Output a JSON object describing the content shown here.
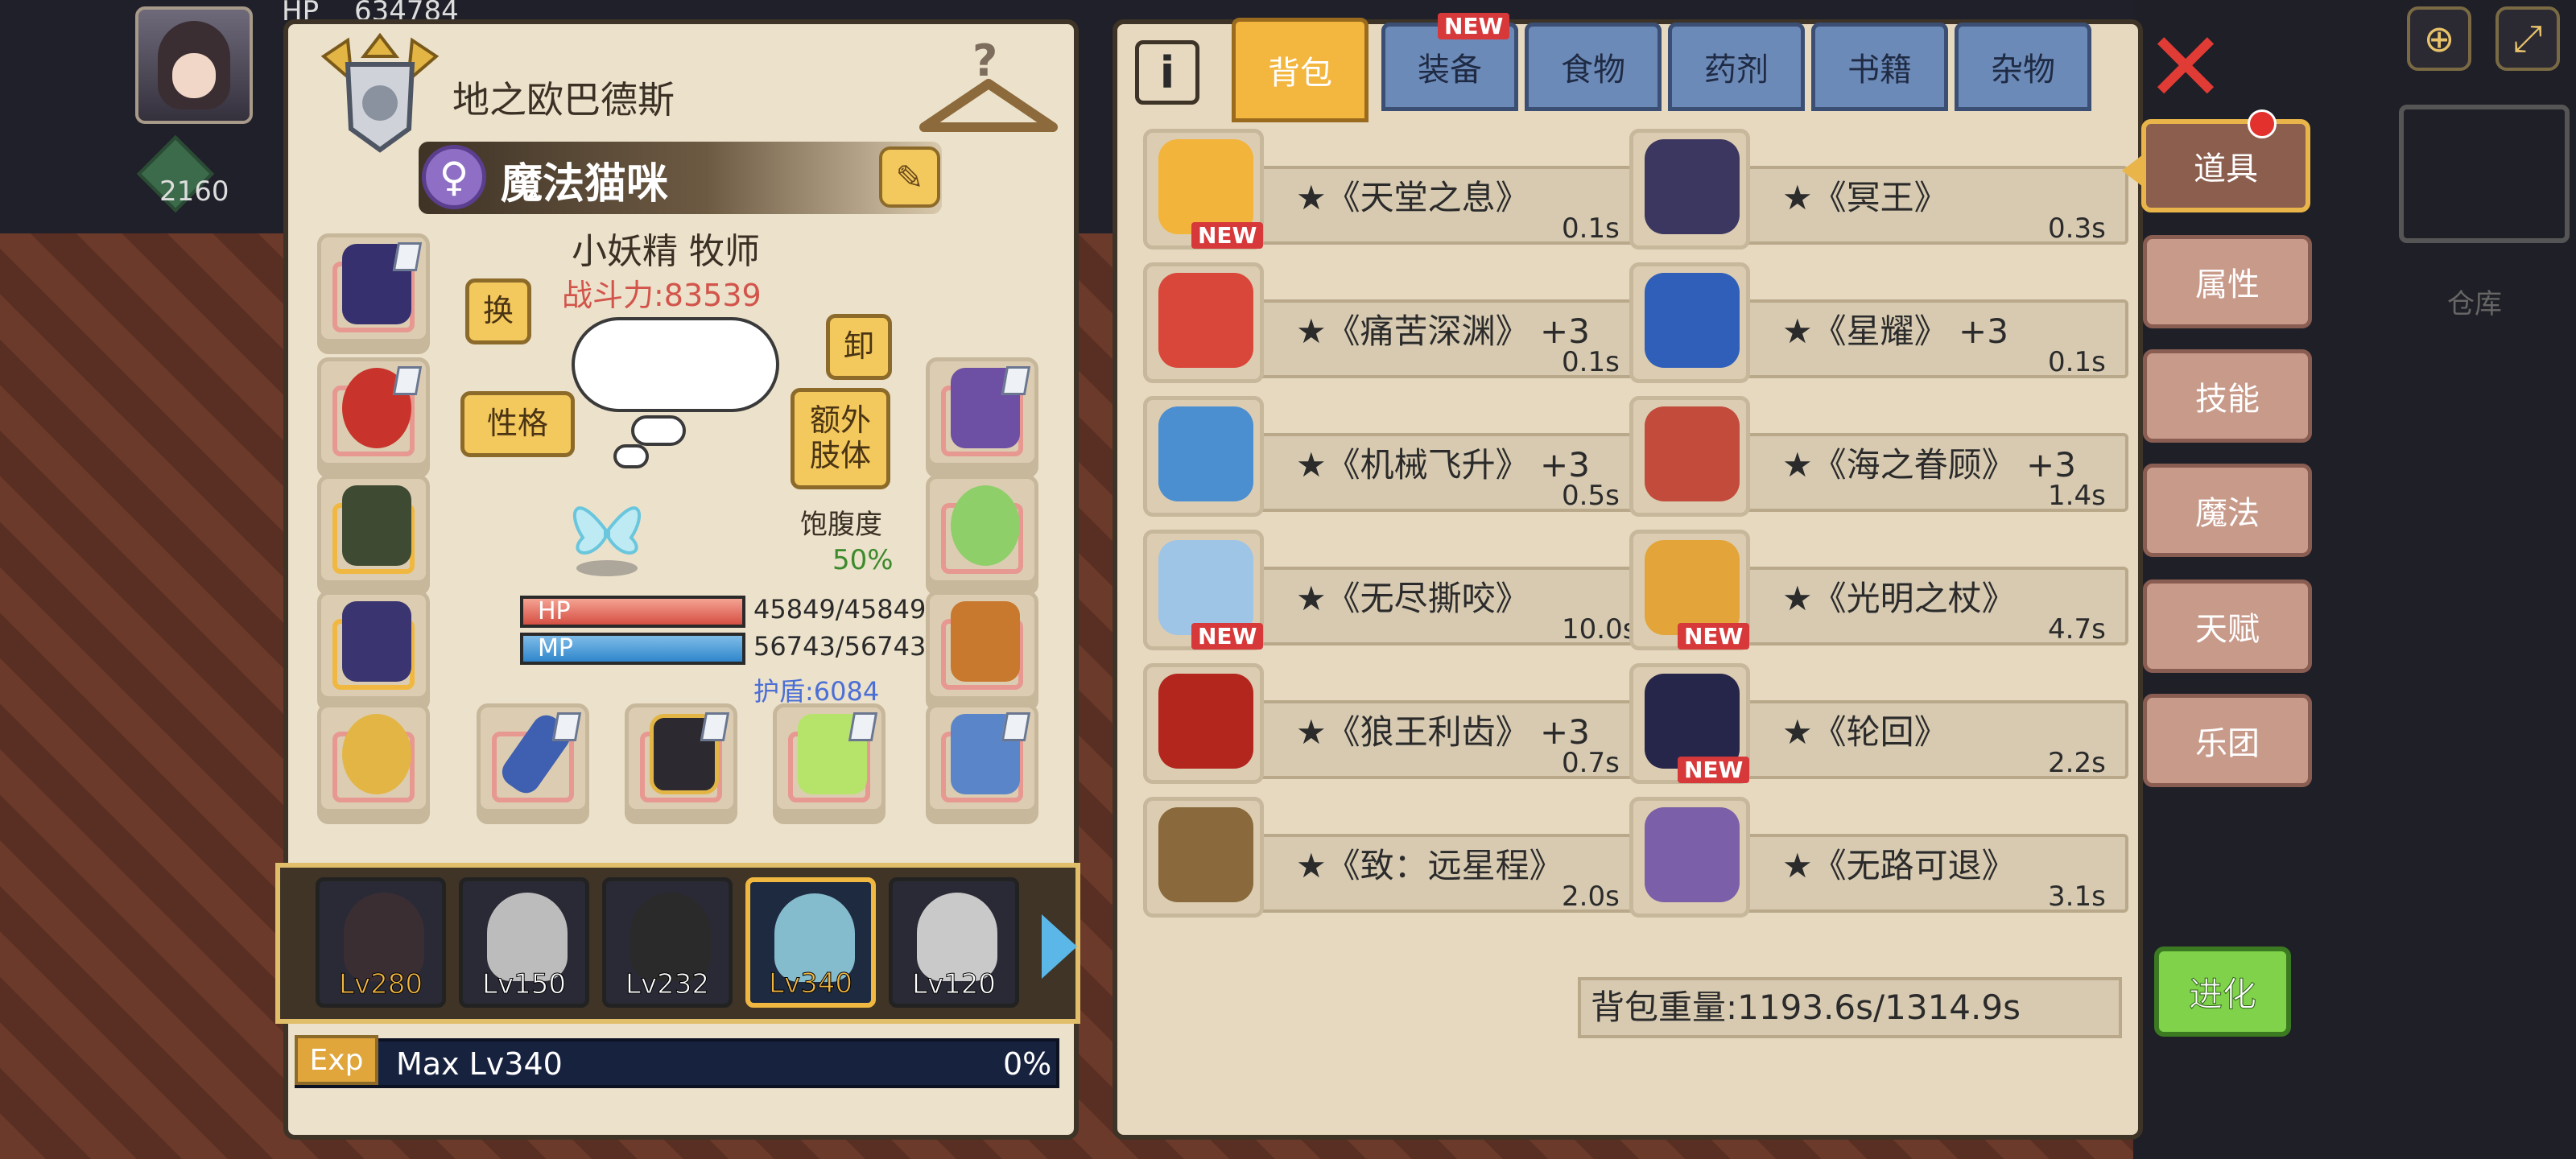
{
  "topbar": {
    "hp_label": "HP",
    "hp_value": "634784",
    "gem_count": "2160"
  },
  "hero": {
    "title": "地之欧巴德斯",
    "pet_name": "魔法猫咪",
    "gender_symbol": "♀",
    "job": "小妖精 牧师",
    "power": "战斗力:83539"
  },
  "buttons": {
    "swap": "换",
    "unequip": "卸",
    "personality": "性格",
    "extra_limb": "额外\n肢体"
  },
  "status": {
    "satiety_label": "饱腹度",
    "satiety_value": "50%",
    "hp_label": "HP",
    "hp_value": "45849/45849",
    "mp_label": "MP",
    "mp_value": "56743/56743",
    "shield": "护盾:6084"
  },
  "party": [
    {
      "level": "Lv280"
    },
    {
      "level": "Lv150"
    },
    {
      "level": "Lv232"
    },
    {
      "level": "Lv340",
      "selected": true
    },
    {
      "level": "Lv120"
    }
  ],
  "exp": {
    "tag": "Exp",
    "text": "Max Lv340",
    "percent": "0%"
  },
  "tabs": [
    {
      "label": "背包",
      "active": true
    },
    {
      "label": "装备",
      "badge": "NEW"
    },
    {
      "label": "食物"
    },
    {
      "label": "药剂"
    },
    {
      "label": "书籍"
    },
    {
      "label": "杂物"
    }
  ],
  "items": [
    {
      "name": "★《天堂之息》",
      "weight": "0.1s",
      "new": true,
      "color": "#f2b43a"
    },
    {
      "name": "★《冥王》",
      "weight": "0.3s",
      "new": false,
      "color": "#3b3760"
    },
    {
      "name": "★《痛苦深渊》 +3",
      "weight": "0.1s",
      "new": false,
      "color": "#d9473a"
    },
    {
      "name": "★《星耀》 +3",
      "weight": "0.1s",
      "new": false,
      "color": "#2f5fb8"
    },
    {
      "name": "★《机械飞升》 +3",
      "weight": "0.5s",
      "new": false,
      "color": "#4b8fd1"
    },
    {
      "name": "★《海之眷顾》 +3",
      "weight": "1.4s",
      "new": false,
      "color": "#c24b3c"
    },
    {
      "name": "★《无尽撕咬》",
      "weight": "10.0s",
      "new": true,
      "color": "#9ec4e6"
    },
    {
      "name": "★《光明之杖》",
      "weight": "4.7s",
      "new": true,
      "color": "#e3a53a"
    },
    {
      "name": "★《狼王利齿》 +3",
      "weight": "0.7s",
      "new": false,
      "color": "#b3261e"
    },
    {
      "name": "★《轮回》",
      "weight": "2.2s",
      "new": true,
      "color": "#26254a"
    },
    {
      "name": "★《致：远星程》",
      "weight": "2.0s",
      "new": false,
      "color": "#8a6a3c"
    },
    {
      "name": "★《无路可退》",
      "weight": "3.1s",
      "new": false,
      "color": "#7b5fa8"
    }
  ],
  "new_label": "NEW",
  "bag_weight": "背包重量:1193.6s/1314.9s",
  "side_tabs": [
    "道具",
    "属性",
    "技能",
    "魔法",
    "天赋",
    "乐团"
  ],
  "evolve": "进化",
  "warehouse": "仓库"
}
